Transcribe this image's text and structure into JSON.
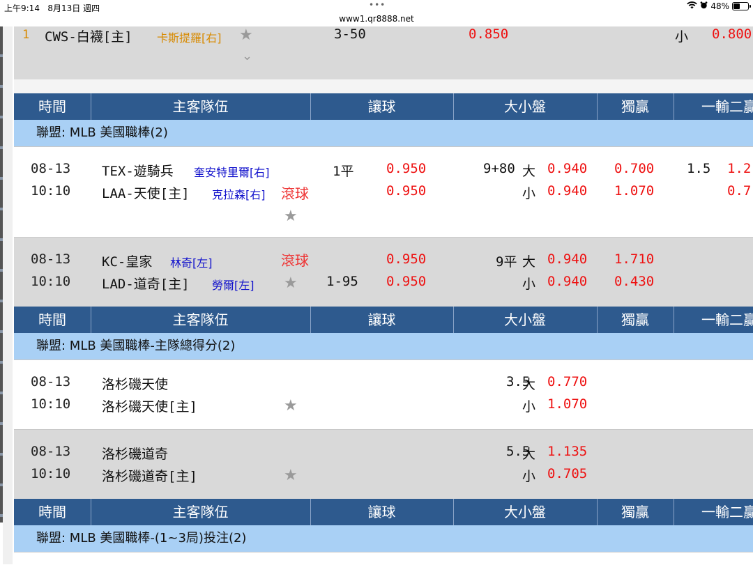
{
  "status": {
    "time": "上午9:14",
    "date": "8月13日 週四",
    "url": "www1.qr8888.net",
    "battery": "48%",
    "battery_level": 0.48
  },
  "headers": {
    "time": "時間",
    "teams": "主客隊伍",
    "handicap": "讓球",
    "over_under": "大小盤",
    "moneyline": "獨贏",
    "runline": "一輸二贏"
  },
  "top_partial": {
    "index": "1",
    "team": "CWS-白襪[主]",
    "pitcher": "卡斯提羅[右]",
    "handicap": "3-50",
    "odds": "0.850",
    "ou_label": "小",
    "ou_odds": "0.800"
  },
  "leagues": [
    "聯盟: MLB 美國職棒(2)",
    "聯盟: MLB 美國職棒-主隊總得分(2)",
    "聯盟: MLB 美國職棒-(1~3局)投注(2)"
  ],
  "game1": {
    "date": "08-13",
    "time": "10:10",
    "away": "TEX-遊騎兵",
    "away_pitcher": "奎安特里爾[右]",
    "home": "LAA-天使[主]",
    "home_pitcher": "克拉森[右]",
    "live": "滾球",
    "hdp_line": "1平",
    "hdp_odds1": "0.950",
    "hdp_odds2": "0.950",
    "ou_line": "9+80",
    "ou_big": "大",
    "ou_small": "小",
    "ou_odds1": "0.940",
    "ou_odds2": "0.940",
    "ml1": "0.700",
    "ml2": "1.070",
    "rl_line": "1.5",
    "rl1": "1.2",
    "rl2": "0.7"
  },
  "game2": {
    "date": "08-13",
    "time": "10:10",
    "away": "KC-皇家",
    "away_pitcher": "林奇[左]",
    "home": "LAD-道奇[主]",
    "home_pitcher": "勞爾[左]",
    "live": "滾球",
    "hdp_line": "1-95",
    "hdp_odds1": "0.950",
    "hdp_odds2": "0.950",
    "ou_line": "9平",
    "ou_big": "大",
    "ou_small": "小",
    "ou_odds1": "0.940",
    "ou_odds2": "0.940",
    "ml1": "1.710",
    "ml2": "0.430"
  },
  "game3": {
    "date": "08-13",
    "time": "10:10",
    "team1": "洛杉磯天使",
    "team2": "洛杉磯天使[主]",
    "ou_line": "3.5",
    "ou_big": "大",
    "ou_small": "小",
    "ou_odds1": "0.770",
    "ou_odds2": "1.070"
  },
  "game4": {
    "date": "08-13",
    "time": "10:10",
    "team1": "洛杉磯道奇",
    "team2": "洛杉磯道奇[主]",
    "ou_line": "5.5",
    "ou_big": "大",
    "ou_small": "小",
    "ou_odds1": "1.135",
    "ou_odds2": "0.705"
  },
  "icons": {
    "star": "★",
    "chevron": "⌄",
    "wifi": "wifi-icon",
    "alarm": "alarm-icon"
  },
  "colors": {
    "header": "#2e5a8e",
    "league": "#a9d0f5",
    "odds": "#ee1111",
    "pitcher": "#1111cc",
    "live": "#ee3333"
  }
}
